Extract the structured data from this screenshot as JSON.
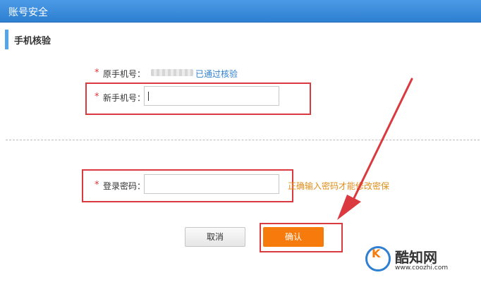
{
  "header": {
    "title": "账号安全"
  },
  "section": {
    "title": "手机核验"
  },
  "form": {
    "required_mark": "*",
    "old_phone_label": "原手机号：",
    "old_phone_status": "已通过核验",
    "new_phone_label": "新手机号：",
    "new_phone_value": "",
    "password_label": "登录密码：",
    "password_value": "",
    "password_hint": "正确输入密码才能修改密保"
  },
  "buttons": {
    "cancel": "取消",
    "confirm": "确认"
  },
  "watermark": {
    "brand": "酷知网",
    "url": "www.coozhi.com",
    "logo_letter": "K"
  },
  "colors": {
    "accent": "#2f7fd2",
    "required": "#e2363a",
    "confirm": "#f77a0c",
    "highlight": "#d9393f"
  }
}
